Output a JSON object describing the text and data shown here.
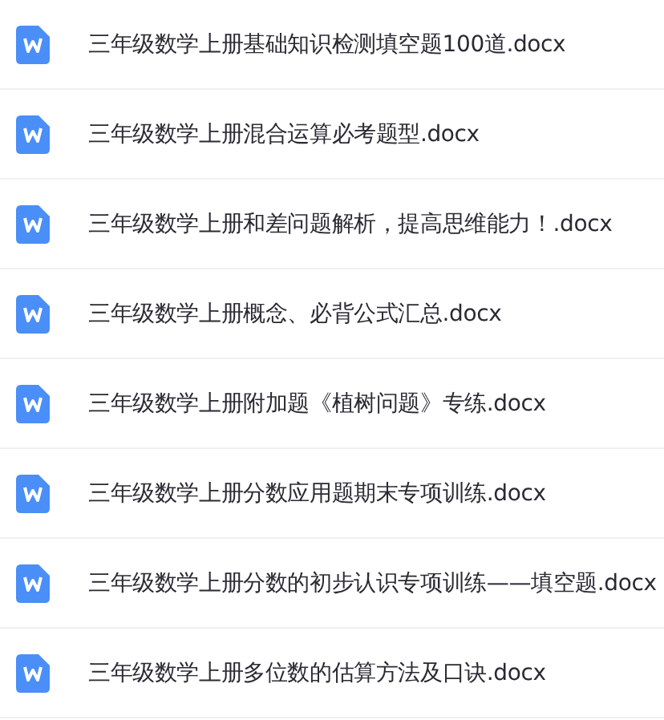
{
  "files": [
    {
      "name": "三年级数学上册基础知识检测填空题100道.docx"
    },
    {
      "name": "三年级数学上册混合运算必考题型.docx"
    },
    {
      "name": "三年级数学上册和差问题解析，提高思维能力！.docx"
    },
    {
      "name": "三年级数学上册概念、必背公式汇总.docx"
    },
    {
      "name": "三年级数学上册附加题《植树问题》专练.docx"
    },
    {
      "name": "三年级数学上册分数应用题期末专项训练.docx"
    },
    {
      "name": "三年级数学上册分数的初步认识专项训练——填空题.docx"
    },
    {
      "name": "三年级数学上册多位数的估算方法及口诀.docx"
    }
  ]
}
